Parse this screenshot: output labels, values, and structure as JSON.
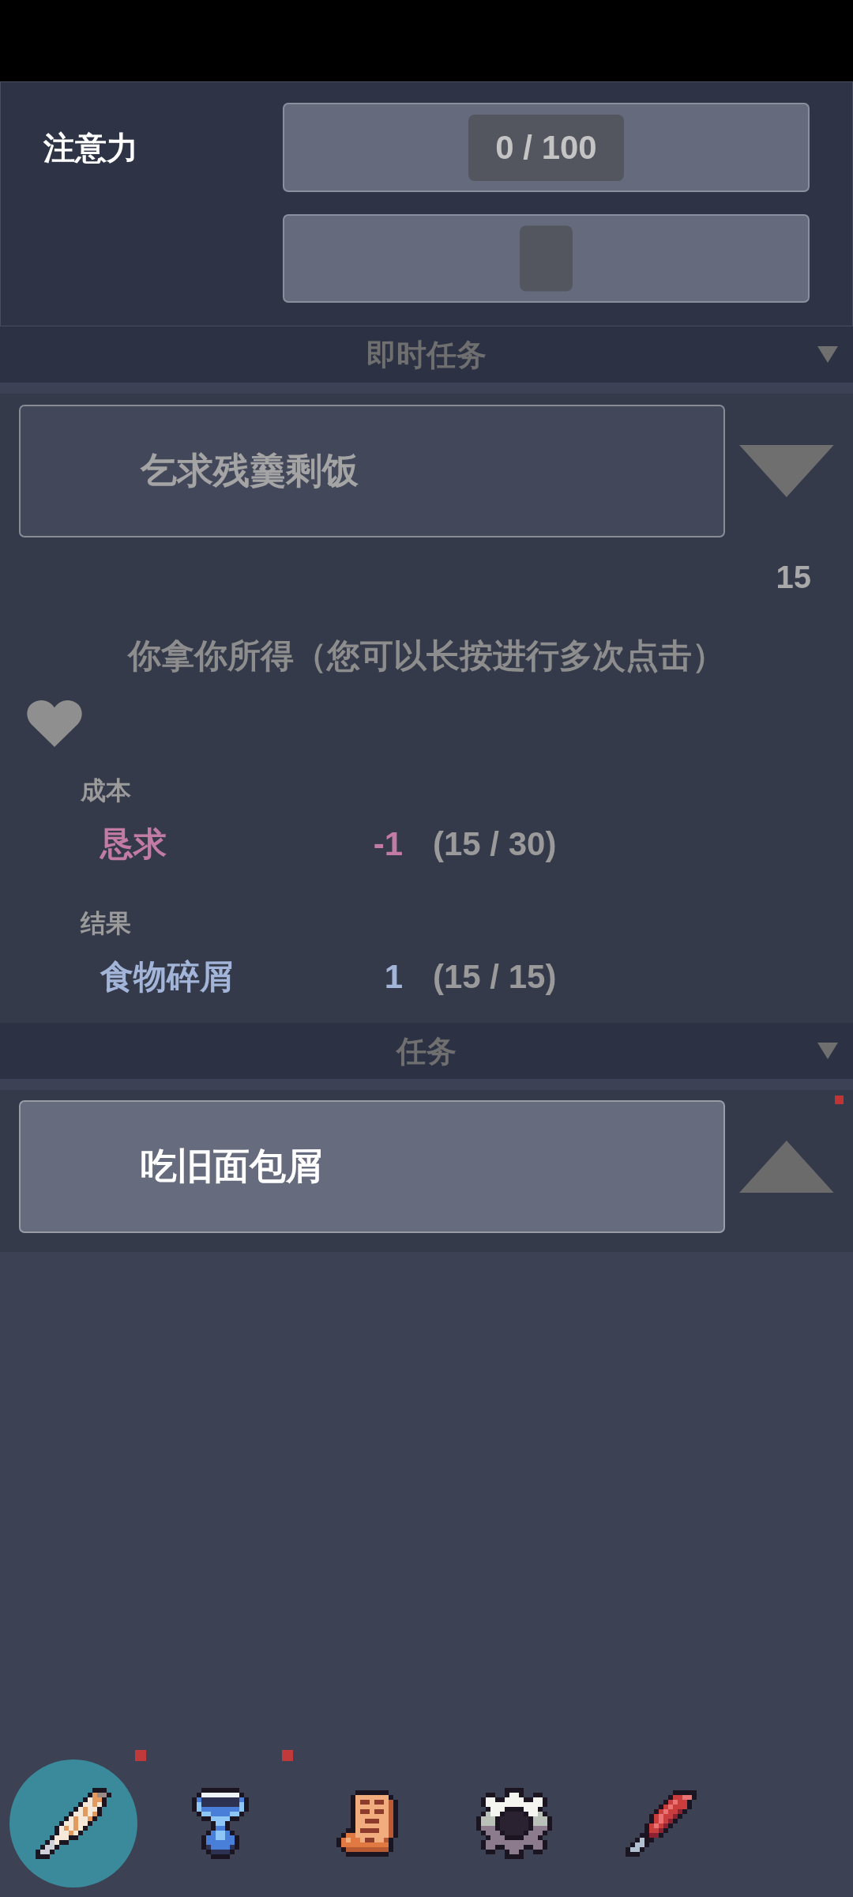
{
  "attention": {
    "label": "注意力",
    "meter": {
      "reading": "0 / 100"
    },
    "slider": {
      "level": 0.5
    }
  },
  "sections": [
    {
      "title": "即时任务",
      "expanded": true,
      "tasks": [
        {
          "label": "乞求残羹剩饭",
          "disabled": true,
          "expanded": true,
          "notify": false,
          "count": "15",
          "description": "你拿你所得（您可以长按进行多次点击）",
          "details": [
            {
              "kind": "cost",
              "title": "成本",
              "items": [
                {
                  "name": "恳求",
                  "amount": "-1",
                  "reading": "(15 / 30)"
                }
              ]
            },
            {
              "kind": "result",
              "title": "结果",
              "items": [
                {
                  "name": "食物碎屑",
                  "amount": "1",
                  "reading": "(15 / 15)"
                }
              ]
            }
          ]
        }
      ]
    },
    {
      "title": "任务",
      "expanded": true,
      "tasks": [
        {
          "label": "吃旧面包屑",
          "disabled": false,
          "expanded": false,
          "notify": true
        }
      ]
    }
  ],
  "nav": [
    {
      "selected": true,
      "notify": true
    },
    {
      "selected": false,
      "notify": true
    },
    {
      "selected": false,
      "notify": false
    },
    {
      "selected": false,
      "notify": false
    },
    {
      "selected": false,
      "notify": false
    }
  ]
}
